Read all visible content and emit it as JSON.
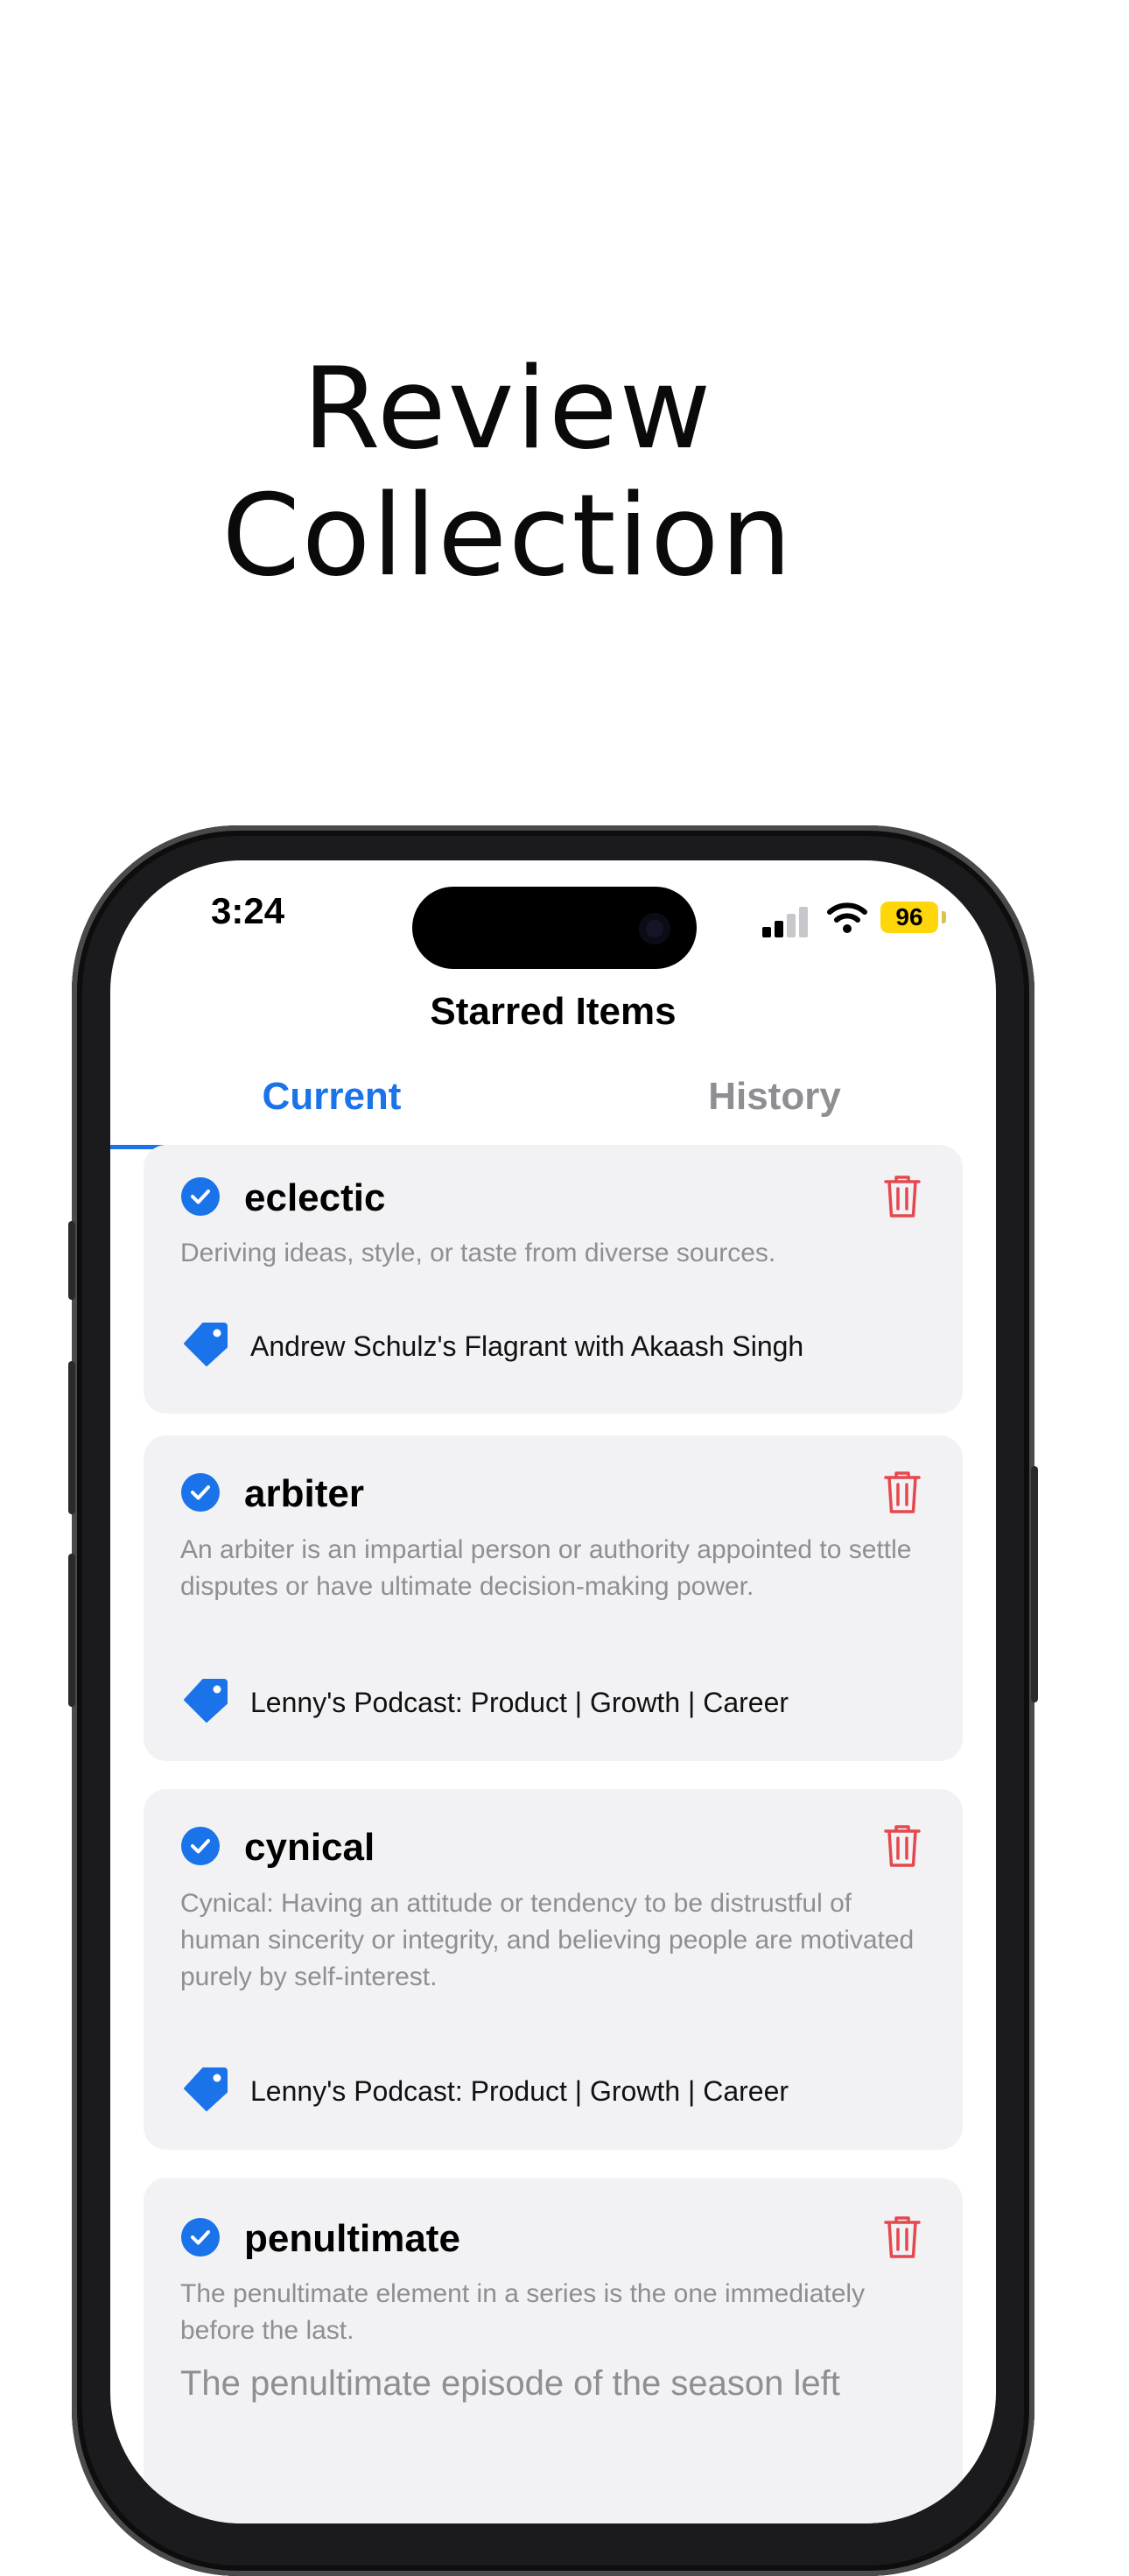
{
  "headline": {
    "line1": "Review",
    "line2": "Collection"
  },
  "status_bar": {
    "time": "3:24",
    "battery": "96"
  },
  "nav": {
    "title": "Starred Items"
  },
  "tabs": {
    "current": "Current",
    "history": "History"
  },
  "cards": [
    {
      "word": "eclectic",
      "definition": "Deriving ideas, style, or taste from diverse sources.",
      "source": "Andrew Schulz's Flagrant with Akaash Singh"
    },
    {
      "word": "arbiter",
      "definition": "An arbiter is an impartial person or authority appointed to settle disputes or have ultimate decision-making power.",
      "source": "Lenny's Podcast: Product | Growth | Career"
    },
    {
      "word": "cynical",
      "definition": "Cynical: Having an attitude or tendency to be distrustful of human sincerity or integrity, and believing people are motivated purely by self-interest.",
      "source": "Lenny's Podcast: Product | Growth | Career"
    },
    {
      "word": "penultimate",
      "definition": "The penultimate element in a series is the one immediately before the last.",
      "example": "The penultimate episode of the season left"
    }
  ],
  "colors": {
    "accent": "#1a73e8",
    "delete": "#e5484d",
    "card_bg": "#f2f2f5",
    "battery": "#ffd60a"
  },
  "icons": {
    "select": "checkmark-circle-icon",
    "delete": "trash-icon",
    "source": "tag-icon"
  }
}
